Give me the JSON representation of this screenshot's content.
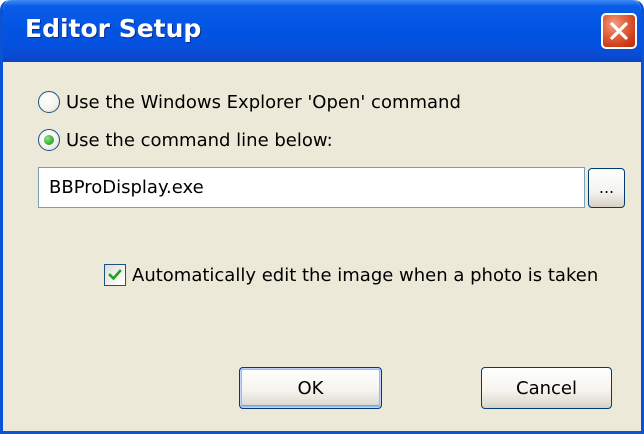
{
  "window": {
    "title": "Editor Setup"
  },
  "options": {
    "explorer_open_label": "Use the Windows Explorer 'Open' command",
    "command_line_label": "Use the command line below:",
    "selected": "command_line"
  },
  "command": {
    "value": "BBProDisplay.exe",
    "browse_label": "..."
  },
  "auto_edit": {
    "label": "Automatically edit the image when a photo is taken",
    "checked": true
  },
  "buttons": {
    "ok_label": "OK",
    "cancel_label": "Cancel"
  },
  "icons": {
    "close": "close-icon",
    "checkmark": "checkmark-icon"
  },
  "colors": {
    "titlebar": "#0254e3",
    "dialog_bg": "#ece9d8",
    "close_button": "#cc3b17",
    "radio_dot": "#3fb43a",
    "checkmark": "#21a121"
  }
}
